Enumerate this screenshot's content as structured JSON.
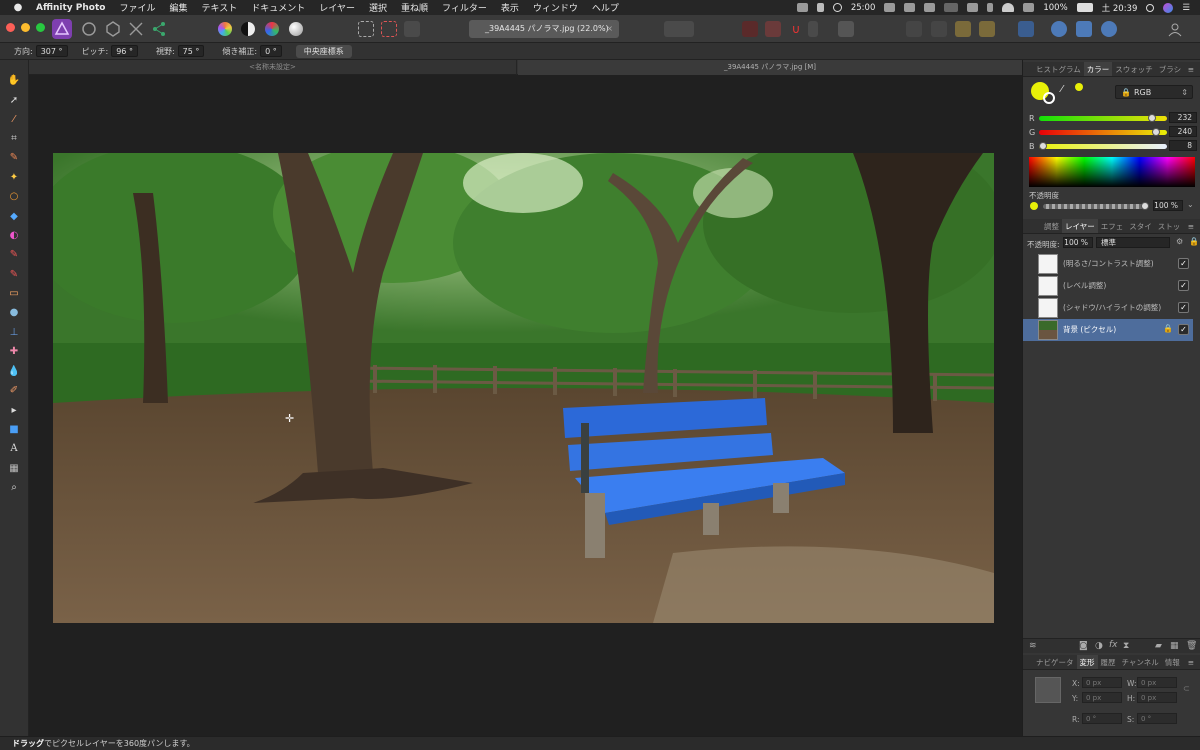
{
  "menubar": {
    "app_name": "Affinity Photo",
    "items": [
      "ファイル",
      "編集",
      "テキスト",
      "ドキュメント",
      "レイヤー",
      "選択",
      "重ね順",
      "フィルター",
      "表示",
      "ウィンドウ",
      "ヘルプ"
    ],
    "clock": "25:00",
    "battery": "100%",
    "date": "土 20:39"
  },
  "toolbar": {
    "document_tab": "_39A4445 パノラマ.jpg (22.0%)",
    "close": "×"
  },
  "context": {
    "direction_label": "方向:",
    "direction_value": "307 °",
    "pitch_label": "ピッチ:",
    "pitch_value": "96 °",
    "fov_label": "視野:",
    "fov_value": "75 °",
    "tilt_label": "傾き補正:",
    "tilt_value": "0 °",
    "center_button": "中央座標系"
  },
  "doc_tabs": {
    "tab1": "<名称未設定>",
    "tab2": "_39A4445 パノラマ.jpg [M]"
  },
  "status": {
    "bold": "ドラッグ",
    "rest": "でピクセルレイヤーを360度パンします。"
  },
  "color_panel": {
    "tabs": [
      "ヒストグラム",
      "カラー",
      "スウォッチ",
      "ブラシ"
    ],
    "active_tab": "カラー",
    "mode": "RGB",
    "r_label": "R",
    "r_value": "232",
    "g_label": "G",
    "g_value": "240",
    "b_label": "B",
    "b_value": "8",
    "r_level": 0.91,
    "g_level": 0.94,
    "b_level": 0.03,
    "opacity_label": "不透明度",
    "opacity_value": "100 %",
    "current_color": "#e8f008"
  },
  "layers_panel": {
    "tabs": [
      "調整",
      "レイヤー",
      "エフェ",
      "スタイ",
      "ストッ"
    ],
    "active_tab": "レイヤー",
    "opacity_label": "不透明度:",
    "opacity_value": "100 %",
    "blend_mode": "標準",
    "layers": [
      {
        "name": "(明るさ/コントラスト調整)",
        "visible": "✓"
      },
      {
        "name": "(レベル調整)",
        "visible": "✓"
      },
      {
        "name": "(シャドウ/ハイライトの調整)",
        "visible": "✓"
      },
      {
        "name": "背景 (ピクセル)",
        "visible": "✓"
      }
    ]
  },
  "transform_panel": {
    "tabs": [
      "ナビゲータ",
      "変形",
      "履歴",
      "チャンネル",
      "情報"
    ],
    "active_tab": "変形",
    "x_label": "X:",
    "x_value": "0 px",
    "y_label": "Y:",
    "y_value": "0 px",
    "w_label": "W:",
    "w_value": "0 px",
    "h_label": "H:",
    "h_value": "0 px",
    "r_label": "R:",
    "r_value": "0 °",
    "s_label": "S:",
    "s_value": "0 °"
  }
}
